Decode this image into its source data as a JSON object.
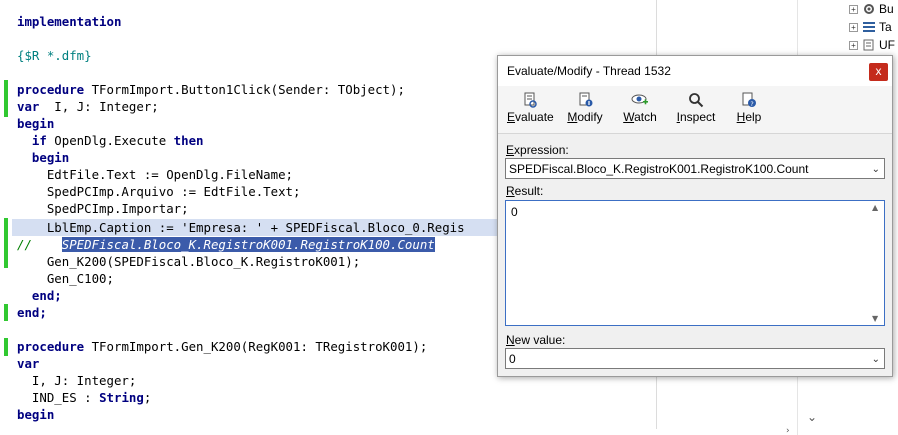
{
  "editor": {
    "lines": [
      {
        "k": "l0",
        "text": "implementation"
      },
      {
        "k": "l1",
        "text": ""
      },
      {
        "k": "l2",
        "text": "{$R *.dfm}"
      },
      {
        "k": "l3",
        "text": ""
      },
      {
        "k": "l4a",
        "text": "procedure"
      },
      {
        "k": "l4b",
        "text": " TFormImport.Button1Click(Sender: TObject);"
      },
      {
        "k": "l5a",
        "text": "var"
      },
      {
        "k": "l5b",
        "text": "  I, J: Integer;"
      },
      {
        "k": "l6",
        "text": "begin"
      },
      {
        "k": "l7a",
        "text": "  if"
      },
      {
        "k": "l7b",
        "text": " OpenDlg.Execute "
      },
      {
        "k": "l7c",
        "text": "then"
      },
      {
        "k": "l8",
        "text": "  begin"
      },
      {
        "k": "l9",
        "text": "    EdtFile.Text := OpenDlg.FileName;"
      },
      {
        "k": "l10",
        "text": "    SpedPCImp.Arquivo := EdtFile.Text;"
      },
      {
        "k": "l11",
        "text": "    SpedPCImp.Importar;"
      },
      {
        "k": "l12",
        "text": "    LblEmp.Caption := 'Empresa: ' + SPEDFiscal.Bloco_0.Regis"
      },
      {
        "k": "l13a",
        "text": "//    "
      },
      {
        "k": "l13b",
        "text": "SPEDFiscal.Bloco_K.RegistroK001.RegistroK100.Count"
      },
      {
        "k": "l14",
        "text": "    Gen_K200(SPEDFiscal.Bloco_K.RegistroK001);"
      },
      {
        "k": "l15",
        "text": "    Gen_C100;"
      },
      {
        "k": "l16",
        "text": "  end;"
      },
      {
        "k": "l17",
        "text": "end;"
      },
      {
        "k": "l18",
        "text": ""
      },
      {
        "k": "l19a",
        "text": "procedure"
      },
      {
        "k": "l19b",
        "text": " TFormImport.Gen_K200(RegK001: TRegistroK001);"
      },
      {
        "k": "l20",
        "text": "var"
      },
      {
        "k": "l21",
        "text": "  I, J: Integer;"
      },
      {
        "k": "l22a",
        "text": "  IND_ES : "
      },
      {
        "k": "l22b",
        "text": "String"
      },
      {
        "k": "l22c",
        "text": ";"
      },
      {
        "k": "l23",
        "text": "begin"
      }
    ]
  },
  "structure": {
    "items": [
      {
        "label": "Bu",
        "icon": "gear-icon"
      },
      {
        "label": "Ta",
        "icon": "stack-icon"
      },
      {
        "label": "UF",
        "icon": "unit-icon"
      }
    ]
  },
  "dialog": {
    "title": "Evaluate/Modify - Thread 1532",
    "close_glyph": "x",
    "tools": [
      {
        "u": "E",
        "rest": "valuate",
        "icon": "evaluate-icon"
      },
      {
        "u": "M",
        "rest": "odify",
        "icon": "modify-icon"
      },
      {
        "u": "W",
        "rest": "atch",
        "icon": "watch-icon"
      },
      {
        "u": "I",
        "rest": "nspect",
        "icon": "inspect-icon"
      },
      {
        "u": "H",
        "rest": "elp",
        "icon": "help-icon"
      }
    ],
    "expression_label_u": "E",
    "expression_label_rest": "xpression:",
    "expression_value": "SPEDFiscal.Bloco_K.RegistroK001.RegistroK100.Count",
    "result_label_u": "R",
    "result_label_rest": "esult:",
    "result_value": "0",
    "newvalue_label_u": "N",
    "newvalue_label_rest": "ew value:",
    "newvalue_value": "0"
  }
}
